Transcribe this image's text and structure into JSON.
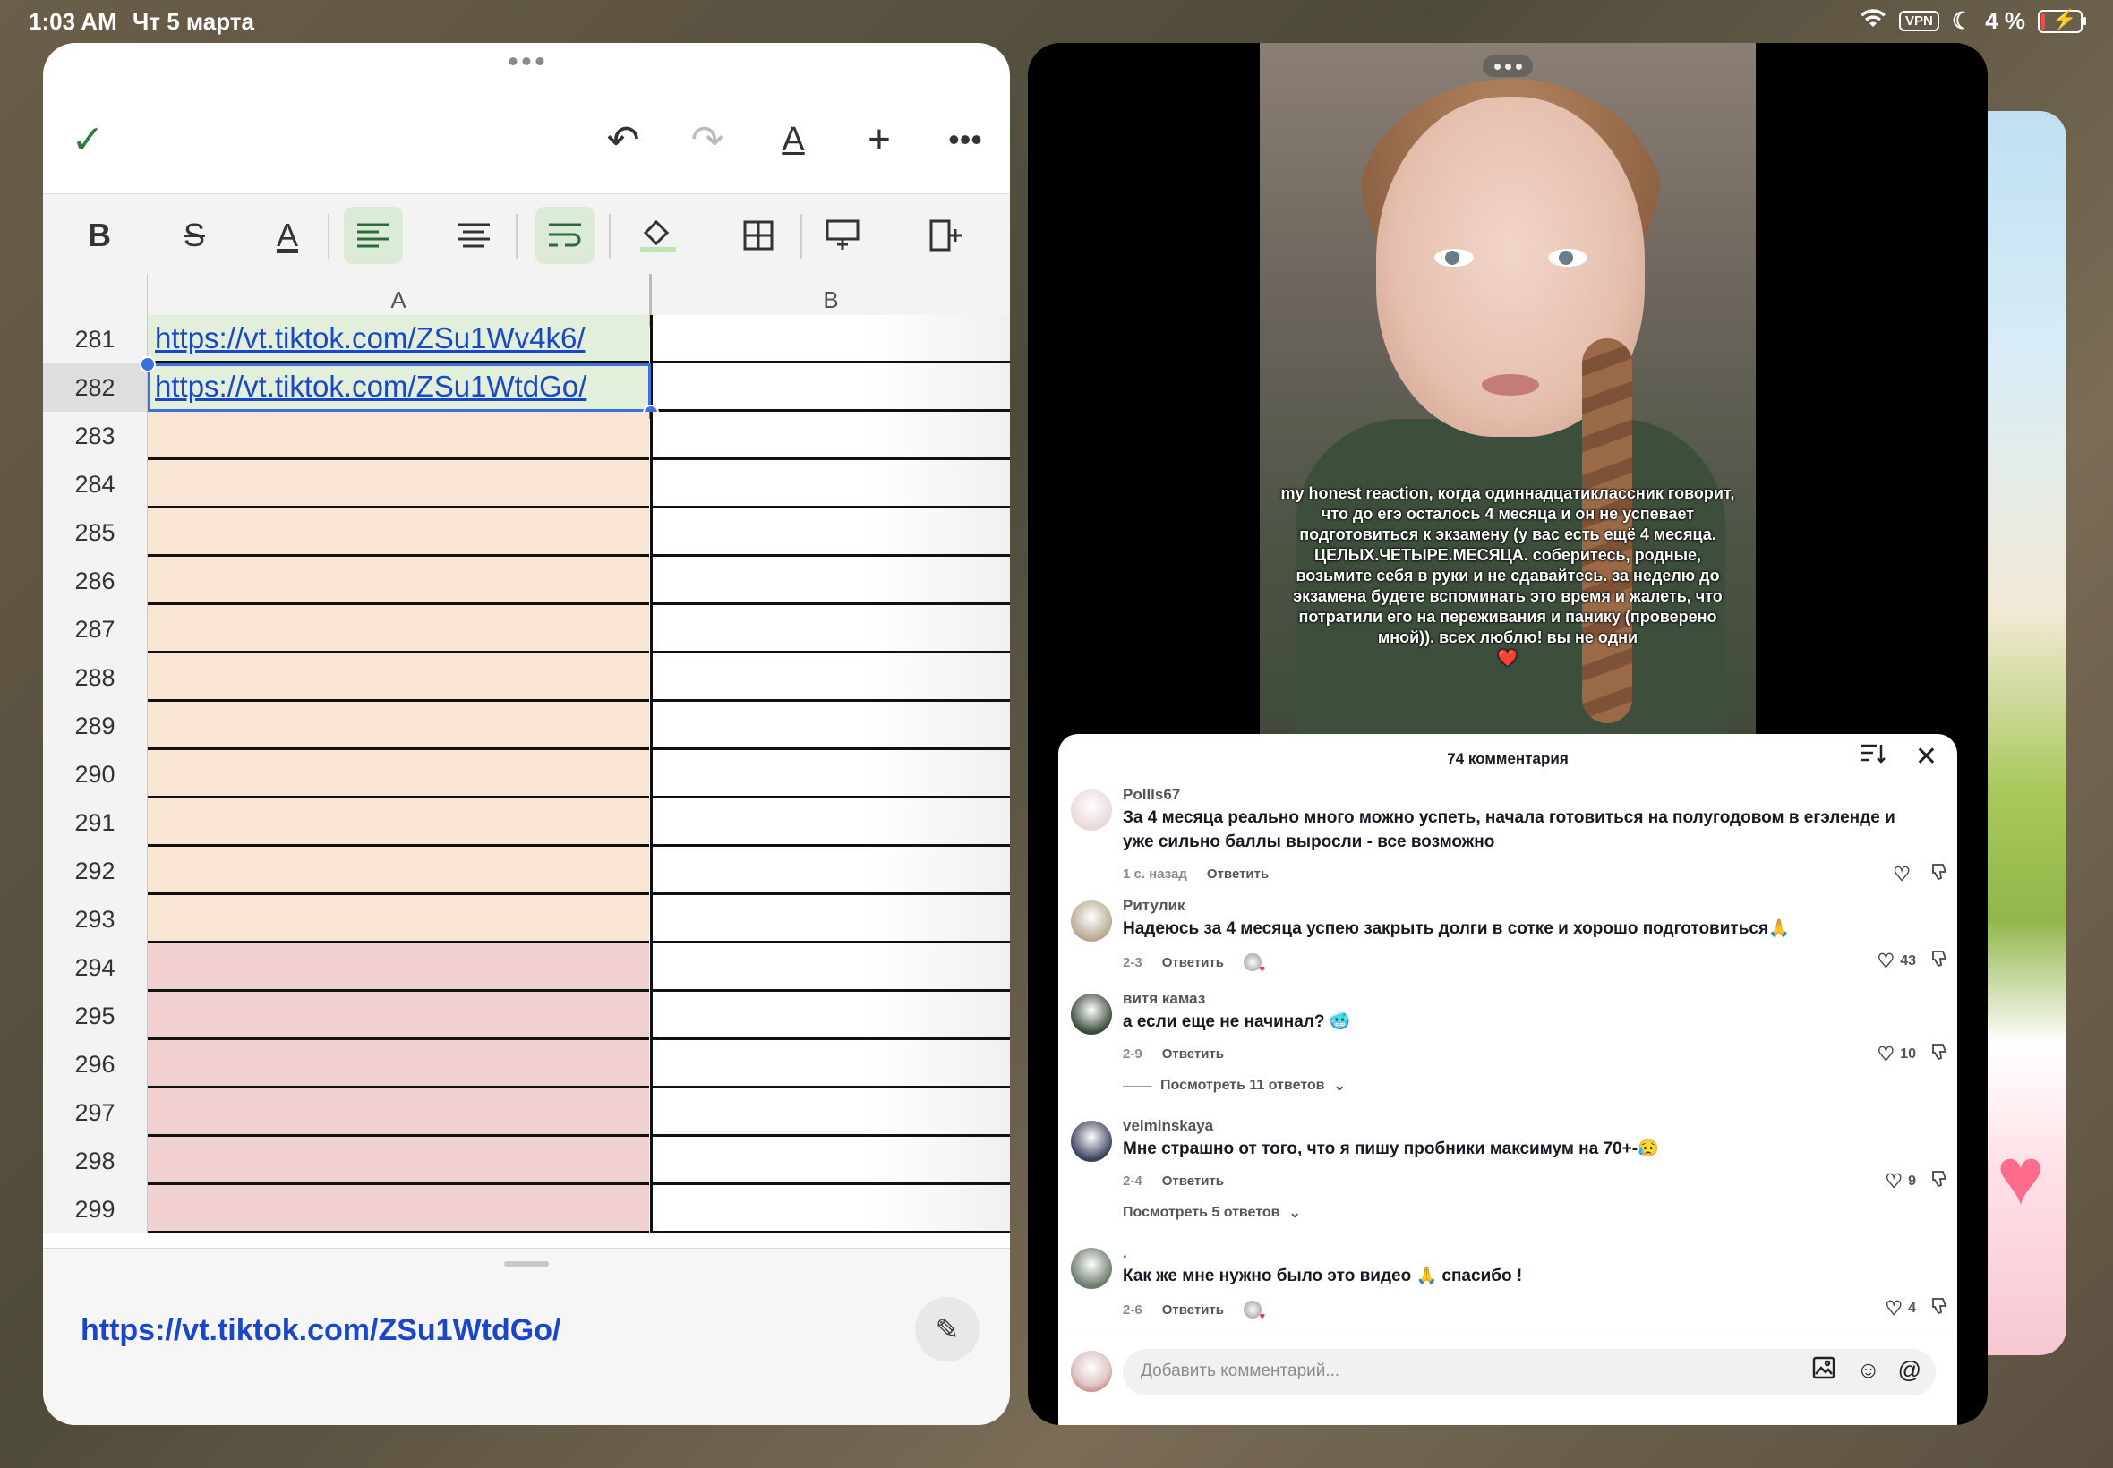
{
  "status_bar": {
    "time": "1:03 AM",
    "date": "Чт 5 марта",
    "vpn": "VPN",
    "battery": "4 %"
  },
  "spreadsheet": {
    "columns": [
      "A",
      "B"
    ],
    "rows": [
      {
        "num": "281",
        "a": "https://vt.tiktok.com/ZSu1Wv4k6/",
        "color": "#e2efda"
      },
      {
        "num": "282",
        "a": "https://vt.tiktok.com/ZSu1WtdGo/",
        "color": "#e2efda"
      },
      {
        "num": "283",
        "a": "",
        "color": "#f8e5d3"
      },
      {
        "num": "284",
        "a": "",
        "color": "#f8e5d3"
      },
      {
        "num": "285",
        "a": "",
        "color": "#f8e5d3"
      },
      {
        "num": "286",
        "a": "",
        "color": "#f8e5d3"
      },
      {
        "num": "287",
        "a": "",
        "color": "#f8e5d3"
      },
      {
        "num": "288",
        "a": "",
        "color": "#f8e5d3"
      },
      {
        "num": "289",
        "a": "",
        "color": "#f8e5d3"
      },
      {
        "num": "290",
        "a": "",
        "color": "#f8e5d3"
      },
      {
        "num": "291",
        "a": "",
        "color": "#f8e5d3"
      },
      {
        "num": "292",
        "a": "",
        "color": "#f8e5d3"
      },
      {
        "num": "293",
        "a": "",
        "color": "#f8e5d3"
      },
      {
        "num": "294",
        "a": "",
        "color": "#f0d0d0"
      },
      {
        "num": "295",
        "a": "",
        "color": "#f0d0d0"
      },
      {
        "num": "296",
        "a": "",
        "color": "#f0d0d0"
      },
      {
        "num": "297",
        "a": "",
        "color": "#f0d0d0"
      },
      {
        "num": "298",
        "a": "",
        "color": "#f0d0d0"
      },
      {
        "num": "299",
        "a": "",
        "color": "#f0d0d0"
      }
    ],
    "selected_row": "282",
    "cell_contents": "https://vt.tiktok.com/ZSu1WtdGo/"
  },
  "video": {
    "caption": "my honest reaction, когда одиннадцатиклассник говорит, что до егэ осталось 4 месяца и он не успевает подготовиться к экзамену (у вас есть ещё 4 месяца. ЦЕЛЫХ.ЧЕТЫРЕ.МЕСЯЦА. соберитесь, родные, возьмите себя в руки и не сдавайтесь. за неделю до экзамена будете вспоминать это время и жалеть, что потратили его на переживания и панику (проверено мной)). всех люблю! вы не одни",
    "caption_emoji": "❤️"
  },
  "comments_panel": {
    "title": "74 комментария",
    "input_placeholder": "Добавить комментарий...",
    "reply_label": "Ответить",
    "comments": [
      {
        "user": "Pollls67",
        "text": "За 4 месяца реально много можно успеть, начала готовиться на полугодовом в егэленде и уже сильно баллы выросли - все возможно",
        "time": "1 с. назад",
        "likes": "",
        "avatar_color": "#e8d8d8"
      },
      {
        "user": "Ритулик",
        "text": "Надеюсь за 4 месяца успею закрыть долги в сотке и хорошо подготовиться🙏",
        "time": "2-3",
        "likes": "43",
        "avatar_color": "#b8a890"
      },
      {
        "user": "витя камаз",
        "text": "а если еще не начинал? 🥶",
        "time": "2-9",
        "likes": "10",
        "avatar_color": "#3a4a3a",
        "replies": "Посмотреть 11 ответов"
      },
      {
        "user": "velminskaya",
        "text": "Мне страшно от того, что я пишу пробники максимум на 70+-😥",
        "time": "2-4",
        "likes": "9",
        "avatar_color": "#3a3f5a",
        "replies": "Посмотреть 5 ответов"
      },
      {
        "user": ".",
        "text": "Как же мне нужно было это видео 🙏 спасибо !",
        "time": "2-6",
        "likes": "4",
        "avatar_color": "#6a7a6a"
      }
    ]
  }
}
